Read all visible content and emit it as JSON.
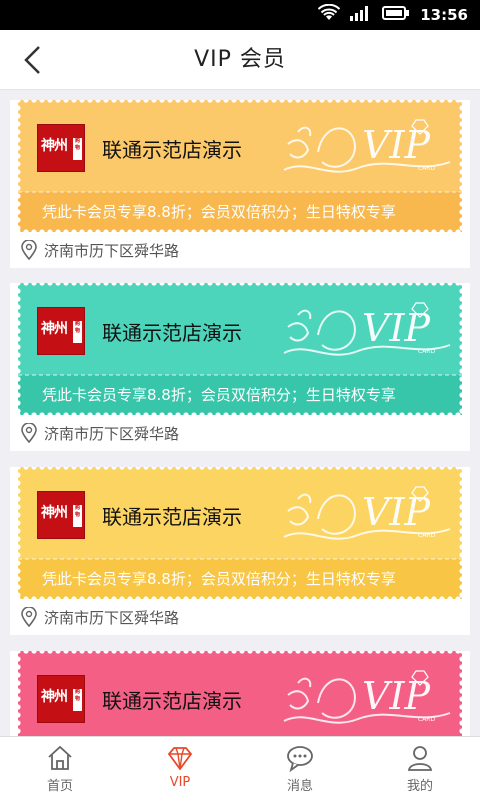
{
  "status_bar": {
    "time": "13:56"
  },
  "header": {
    "title": "VIP 会员"
  },
  "cards": [
    {
      "color": "#fbc86a",
      "stripe": "#f8b84d",
      "logo_text": "神州",
      "logo_sub": "购物",
      "store_name": "联通示范店演示",
      "benefits": "凭此卡会员专享8.8折；会员双倍积分；生日特权专享",
      "address": "济南市历下区舜华路"
    },
    {
      "color": "#4dd5bb",
      "stripe": "#37c6a9",
      "logo_text": "神州",
      "logo_sub": "购物",
      "store_name": "联通示范店演示",
      "benefits": "凭此卡会员专享8.8折；会员双倍积分；生日特权专享",
      "address": "济南市历下区舜华路"
    },
    {
      "color": "#fcd462",
      "stripe": "#f8c545",
      "logo_text": "神州",
      "logo_sub": "购物",
      "store_name": "联通示范店演示",
      "benefits": "凭此卡会员专享8.8折；会员双倍积分；生日特权专享",
      "address": "济南市历下区舜华路"
    },
    {
      "color": "#f45f85",
      "stripe": "#ee4b74",
      "logo_text": "神州",
      "logo_sub": "购物",
      "store_name": "联通示范店演示",
      "benefits": "",
      "address": ""
    }
  ],
  "tabs": [
    {
      "label": "首页",
      "icon": "home-icon",
      "active": false
    },
    {
      "label": "VIP",
      "icon": "diamond-icon",
      "active": true
    },
    {
      "label": "消息",
      "icon": "message-icon",
      "active": false
    },
    {
      "label": "我的",
      "icon": "person-icon",
      "active": false
    }
  ],
  "colors": {
    "accent": "#e8492b",
    "logo_red": "#c40f14"
  }
}
